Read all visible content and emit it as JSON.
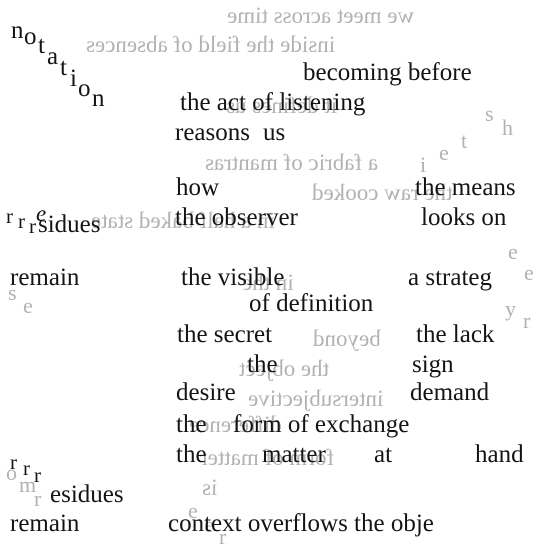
{
  "reversed_background_lines": [
    {
      "text": "we meet  across time"
    },
    {
      "text": "inside the field  of absences"
    },
    {
      "text": "it defines us"
    },
    {
      "text": "a fabric of mantras"
    },
    {
      "text": "the raw cooked"
    },
    {
      "text": "in a half baked state"
    },
    {
      "text": "in the"
    },
    {
      "text": "beyond"
    },
    {
      "text": "the object"
    },
    {
      "text": "intersubjective"
    },
    {
      "text": "difference"
    },
    {
      "text": "form of matter"
    },
    {
      "text": "is"
    }
  ],
  "background_stray_letters": [
    "s",
    "h",
    "t",
    "e",
    "i",
    "e",
    "e",
    "s",
    "e",
    "y",
    "r",
    "o",
    "m",
    "r",
    "e",
    "e",
    "r"
  ],
  "notation_letters": [
    "n",
    "o",
    "t",
    "a",
    "t",
    "i",
    "o",
    "n"
  ],
  "residues_cluster_1": {
    "letters": [
      "r",
      "r",
      "r",
      "e"
    ],
    "word": "sidues"
  },
  "residues_cluster_2": {
    "letters": [
      "r",
      "r",
      "r"
    ],
    "word": "esidues"
  },
  "lines": [
    {
      "text": "becoming before"
    },
    {
      "text": "the act  of listening"
    },
    {
      "text": "reasons"
    },
    {
      "text": "us"
    },
    {
      "text": "how"
    },
    {
      "text": "the means"
    },
    {
      "text": "the observer"
    },
    {
      "text": "looks on"
    },
    {
      "text": "remain"
    },
    {
      "text": "the visible"
    },
    {
      "text": "a strateg"
    },
    {
      "text": "of definition"
    },
    {
      "text": "the secret"
    },
    {
      "text": "the lack"
    },
    {
      "text": "the"
    },
    {
      "text": "sign"
    },
    {
      "text": "desire"
    },
    {
      "text": "demand"
    },
    {
      "text": "the"
    },
    {
      "text": "form  of  exchange"
    },
    {
      "text": "the"
    },
    {
      "text": "matter"
    },
    {
      "text": "at"
    },
    {
      "text": "hand"
    },
    {
      "text": "remain"
    },
    {
      "text": "context overflows the obje"
    }
  ]
}
